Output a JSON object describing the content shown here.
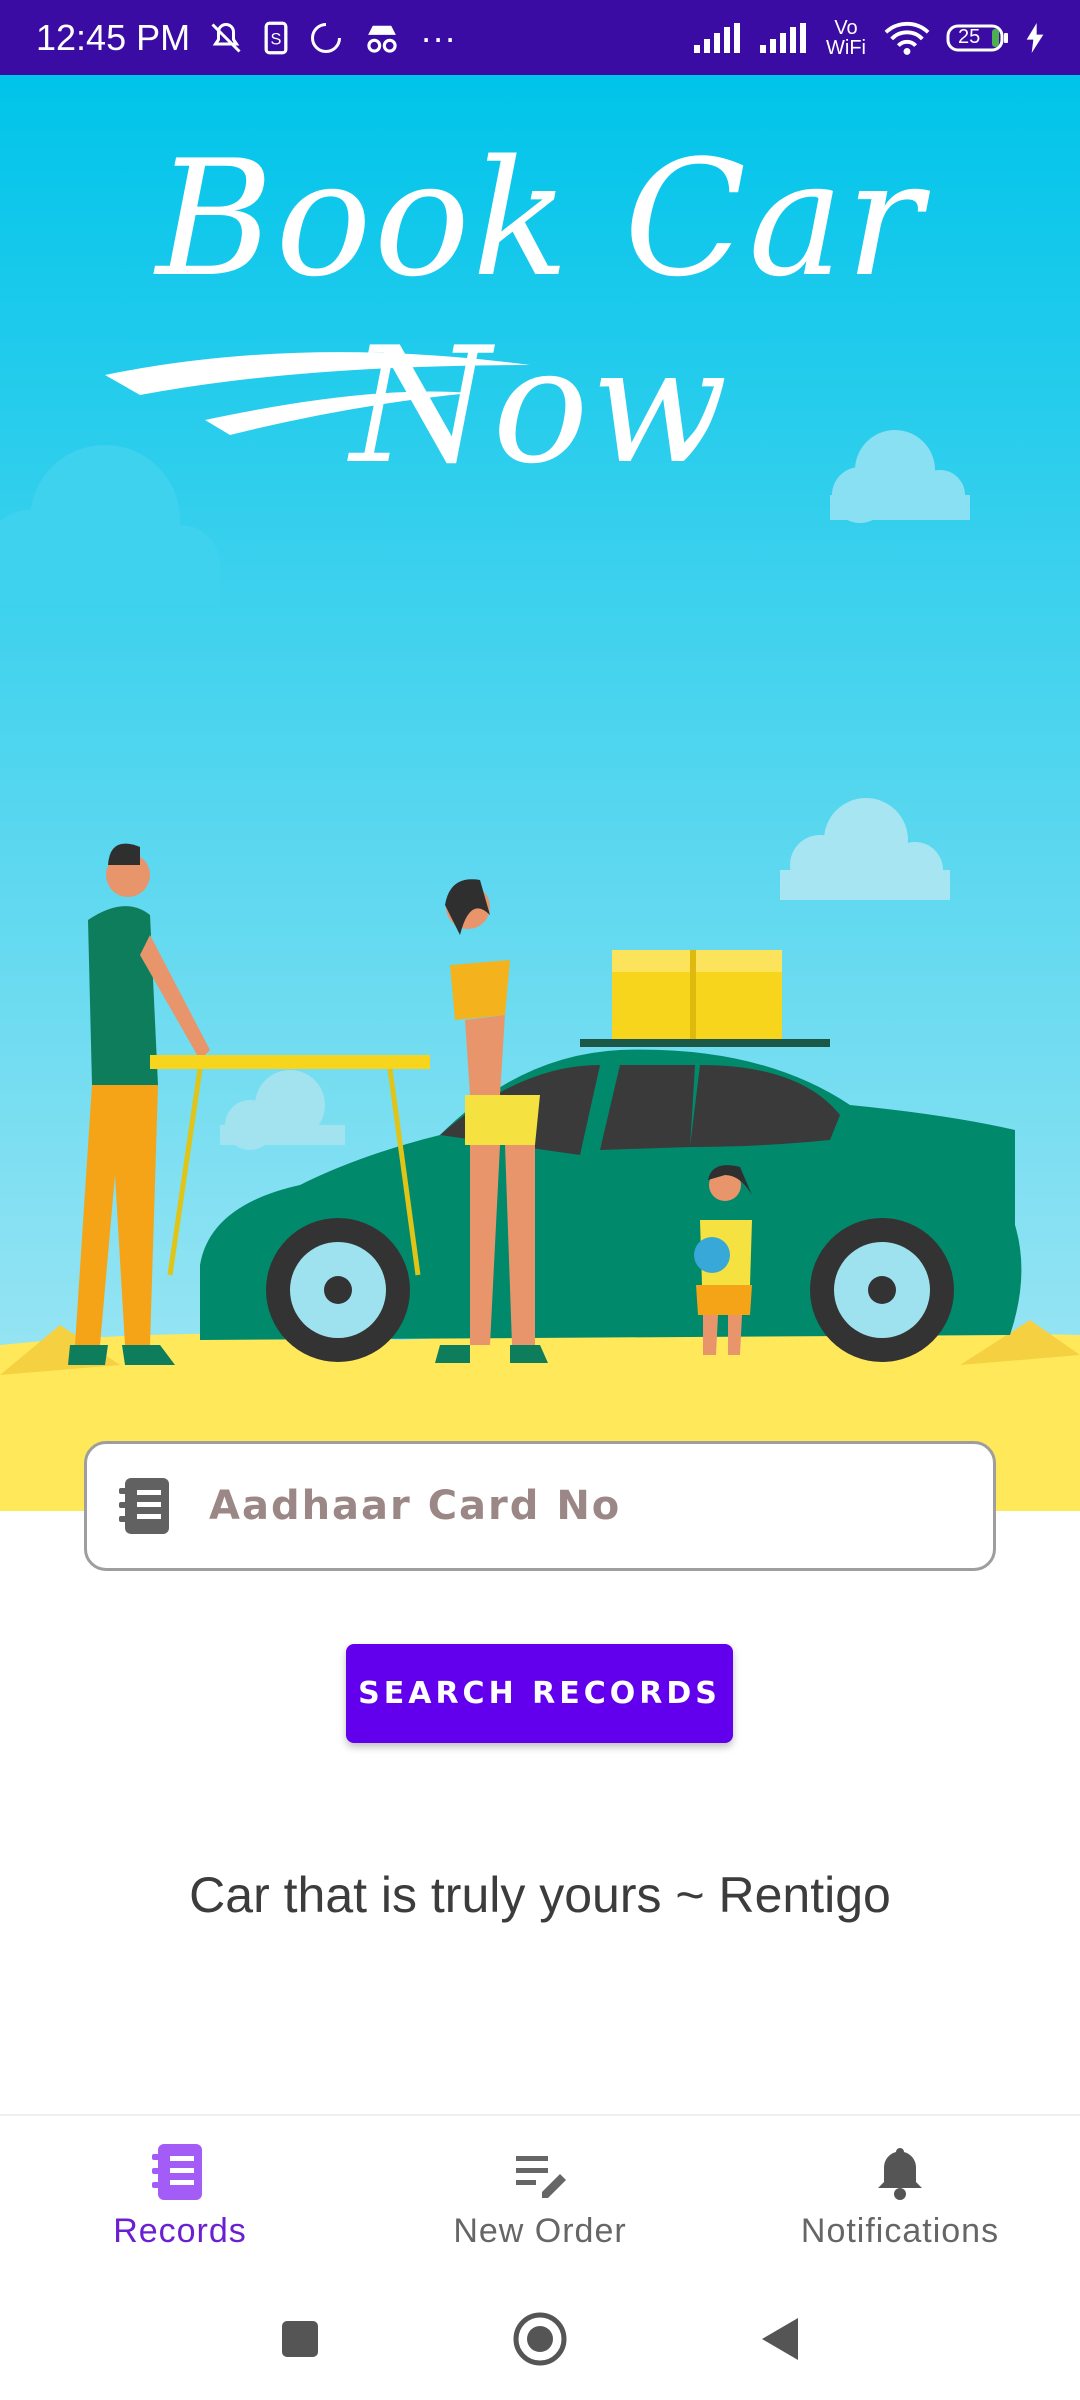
{
  "status_bar": {
    "time": "12:45 PM",
    "more": "···",
    "battery": "25",
    "network_label": "Vo WiFi"
  },
  "hero": {
    "title": "Book Car Now"
  },
  "search": {
    "placeholder": "Aadhaar Card No",
    "icon": "notebook-icon"
  },
  "actions": {
    "search_label": "SEARCH RECORDS"
  },
  "tagline": "Car that is truly yours  ~ Rentigo",
  "bottom_nav": {
    "items": [
      {
        "label": "Records",
        "icon": "records-icon",
        "active": true
      },
      {
        "label": "New Order",
        "icon": "edit-list-icon",
        "active": false
      },
      {
        "label": "Notifications",
        "icon": "bell-icon",
        "active": false
      }
    ]
  },
  "colors": {
    "status_bar": "#3a0ca3",
    "accent": "#6200ee",
    "active_nav": "#6a1fd1",
    "sky_top": "#00c4ea",
    "sand": "#ffe85a",
    "car": "#00896a"
  }
}
